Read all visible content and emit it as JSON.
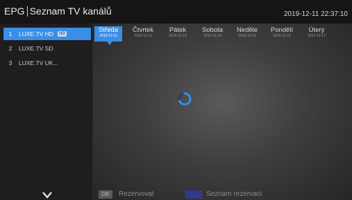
{
  "header": {
    "brand": "EPG",
    "title": "Seznam TV kanálů",
    "datetime": "2019-12-11 22:37:10"
  },
  "channels": [
    {
      "number": "1",
      "name": "LUXE.TV HD",
      "badge": "HD",
      "active": true
    },
    {
      "number": "2",
      "name": "LUXE.TV SD"
    },
    {
      "number": "3",
      "name": "LUXE.TV UK..."
    }
  ],
  "days": [
    {
      "name": "Středa",
      "date": "2019-12-11",
      "active": true
    },
    {
      "name": "Čtvrtek",
      "date": "2019-12-12"
    },
    {
      "name": "Pátek",
      "date": "2019-12-13"
    },
    {
      "name": "Sobota",
      "date": "2019-12-14"
    },
    {
      "name": "Neděle",
      "date": "2019-12-15"
    },
    {
      "name": "Pondělí",
      "date": "2019-12-16"
    },
    {
      "name": "Úterý",
      "date": "2019-12-17"
    }
  ],
  "footer": {
    "ok_key": "OK",
    "ok_label": "Rezervovat",
    "blue_label": "Seznam rezervací"
  },
  "colors": {
    "accent": "#3a8ee6",
    "blue_key": "#2f3a8a"
  },
  "icons": {
    "loading": "spinner-icon",
    "scroll_down": "chevron-down-icon"
  }
}
